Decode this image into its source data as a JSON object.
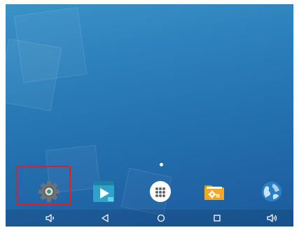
{
  "dock": {
    "apps": [
      {
        "name": "settings-app-icon",
        "icon": "gear-icon",
        "accent": "#6d7276"
      },
      {
        "name": "media-player-app-icon",
        "icon": "play-icon",
        "accent": "#2fa2c9"
      },
      {
        "name": "app-drawer-button",
        "icon": "grid-dots-icon",
        "accent": "#ffffff"
      },
      {
        "name": "file-manager-app-icon",
        "icon": "folder-gear-icon",
        "accent": "#f5a623"
      },
      {
        "name": "browser-app-icon",
        "icon": "globe-icon",
        "accent": "#2a7fc4"
      }
    ],
    "selected_index": 0,
    "highlight_color": "#e02020"
  },
  "home_page_indicator": {
    "pages": 1,
    "current": 1
  },
  "navigation_bar": {
    "buttons": [
      "volume-down-icon",
      "back-icon",
      "home-icon",
      "recents-icon",
      "volume-up-icon"
    ]
  }
}
